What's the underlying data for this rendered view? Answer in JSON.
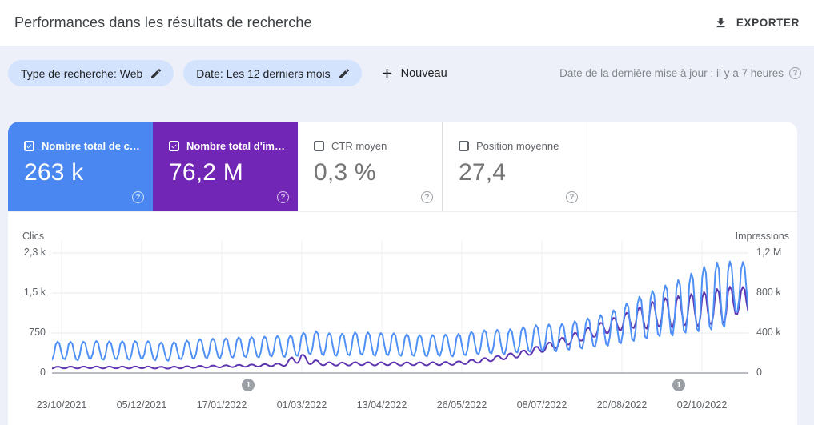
{
  "header": {
    "title": "Performances dans les résultats de recherche",
    "export_label": "EXPORTER"
  },
  "filters": {
    "search_type_chip": "Type de recherche: Web",
    "date_chip": "Date: Les 12 derniers mois",
    "new_label": "Nouveau",
    "last_update": "Date de la dernière mise à jour : il y a 7 heures",
    "help_glyph": "?"
  },
  "metrics": [
    {
      "label": "Nombre total de c…",
      "value": "263 k",
      "checked": true,
      "bg": "#4a87f0"
    },
    {
      "label": "Nombre total d'im…",
      "value": "76,2 M",
      "checked": true,
      "bg": "#7126b5"
    },
    {
      "label": "CTR moyen",
      "value": "0,3 %",
      "checked": false,
      "bg": ""
    },
    {
      "label": "Position moyenne",
      "value": "27,4",
      "checked": false,
      "bg": ""
    }
  ],
  "chart_data": {
    "type": "line",
    "left_axis": {
      "label": "Clics",
      "ticks": [
        "2,3 k",
        "1,5 k",
        "750",
        "0"
      ],
      "max": 2300,
      "units_per_gridline": 750
    },
    "right_axis": {
      "label": "Impressions",
      "ticks": [
        "1,2 M",
        "800 k",
        "400 k",
        "0"
      ],
      "max": 1200000,
      "units_per_gridline": 400000
    },
    "x_ticks": [
      "23/10/2021",
      "05/12/2021",
      "17/01/2022",
      "01/03/2022",
      "13/04/2022",
      "26/05/2022",
      "08/07/2022",
      "20/08/2022",
      "02/10/2022"
    ],
    "grid": true,
    "week_pattern": [
      0.05,
      0.3,
      0.85,
      1.0,
      0.9,
      0.45,
      0.1
    ],
    "series": [
      {
        "name": "Clics",
        "axis": "left",
        "color": "#4e90f5",
        "weekly_peak": [
          580,
          600,
          570,
          610,
          590,
          600,
          590,
          610,
          580,
          560,
          600,
          620,
          650,
          640,
          660,
          680,
          670,
          700,
          690,
          720,
          800,
          760,
          730,
          750,
          780,
          740,
          760,
          730,
          720,
          700,
          730,
          710,
          760,
          790,
          820,
          800,
          850,
          880,
          920,
          900,
          950,
          1000,
          1060,
          1120,
          1250,
          1380,
          1500,
          1600,
          1700,
          1800,
          1950,
          2050,
          2100,
          2080
        ],
        "weekly_trough": [
          230,
          240,
          220,
          250,
          230,
          240,
          230,
          250,
          220,
          210,
          240,
          250,
          260,
          260,
          270,
          280,
          270,
          290,
          280,
          300,
          330,
          310,
          300,
          310,
          320,
          300,
          310,
          300,
          300,
          290,
          300,
          290,
          310,
          330,
          340,
          330,
          360,
          370,
          390,
          380,
          410,
          430,
          460,
          480,
          520,
          560,
          600,
          640,
          650,
          700,
          720,
          750,
          800,
          1100
        ]
      },
      {
        "name": "Impressions",
        "axis": "right",
        "unit": "thousands",
        "color": "#5e35b1",
        "weekly_peak": [
          62,
          65,
          63,
          66,
          64,
          65,
          64,
          66,
          63,
          62,
          66,
          70,
          74,
          76,
          80,
          84,
          86,
          92,
          96,
          215,
          140,
          110,
          104,
          106,
          110,
          106,
          108,
          106,
          108,
          106,
          110,
          112,
          124,
          140,
          160,
          185,
          210,
          245,
          285,
          330,
          380,
          430,
          480,
          530,
          580,
          630,
          690,
          740,
          760,
          780,
          800,
          820,
          864,
          860
        ],
        "weekly_trough": [
          44,
          46,
          45,
          47,
          45,
          46,
          45,
          47,
          44,
          43,
          46,
          50,
          53,
          55,
          58,
          61,
          63,
          67,
          70,
          95,
          85,
          75,
          72,
          74,
          77,
          74,
          76,
          74,
          76,
          74,
          77,
          79,
          88,
          100,
          116,
          134,
          152,
          178,
          208,
          242,
          280,
          318,
          356,
          392,
          420,
          440,
          430,
          450,
          440,
          460,
          450,
          470,
          480,
          576
        ]
      }
    ],
    "annotations": [
      {
        "label": "1",
        "x_frac": 0.282
      },
      {
        "label": "1",
        "x_frac": 0.9
      }
    ]
  }
}
